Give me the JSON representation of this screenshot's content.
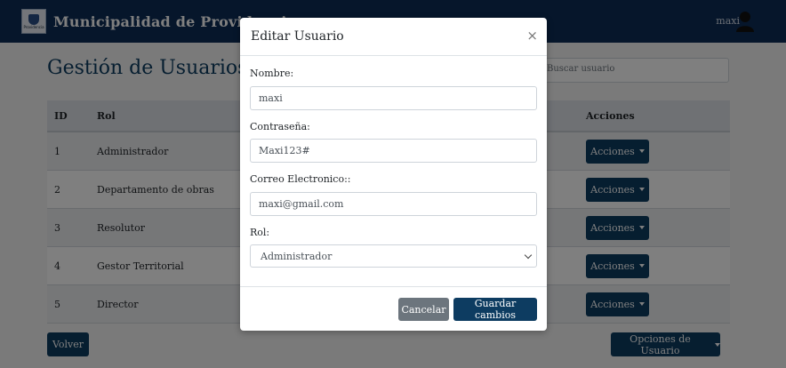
{
  "navbar": {
    "brand": "Municipalidad de Providencia",
    "logo_text": "Providencia",
    "user_name": "maxi",
    "user_icon": "user-icon"
  },
  "page": {
    "title": "Gestión de Usuarios",
    "search_placeholder": "Buscar usuario"
  },
  "table": {
    "headers": {
      "id": "ID",
      "rol": "Rol",
      "acciones": "Acciones"
    },
    "rows": [
      {
        "id": "1",
        "rol": "Administrador",
        "action": "Acciones"
      },
      {
        "id": "2",
        "rol": "Departamento de obras",
        "action": "Acciones"
      },
      {
        "id": "3",
        "rol": "Resolutor",
        "action": "Acciones"
      },
      {
        "id": "4",
        "rol": "Gestor Territorial",
        "action": "Acciones"
      },
      {
        "id": "5",
        "rol": "Director",
        "action": "Acciones"
      }
    ]
  },
  "footer": {
    "volver": "Volver",
    "opciones": "Opciones de Usuario"
  },
  "modal": {
    "title": "Editar Usuario",
    "close": "×",
    "nombre_label": "Nombre:",
    "nombre_value": "maxi",
    "password_label": "Contraseña:",
    "password_value": "Maxi123#",
    "email_label": "Correo Electronico::",
    "email_value": "maxi@gmail.com",
    "rol_label": "Rol:",
    "rol_value": "Administrador",
    "cancel": "Cancelar",
    "save": "Guardar cambios"
  },
  "colors": {
    "primary": "#0d3c61",
    "navbar": "#0c2d57",
    "secondary": "#6c757d"
  }
}
